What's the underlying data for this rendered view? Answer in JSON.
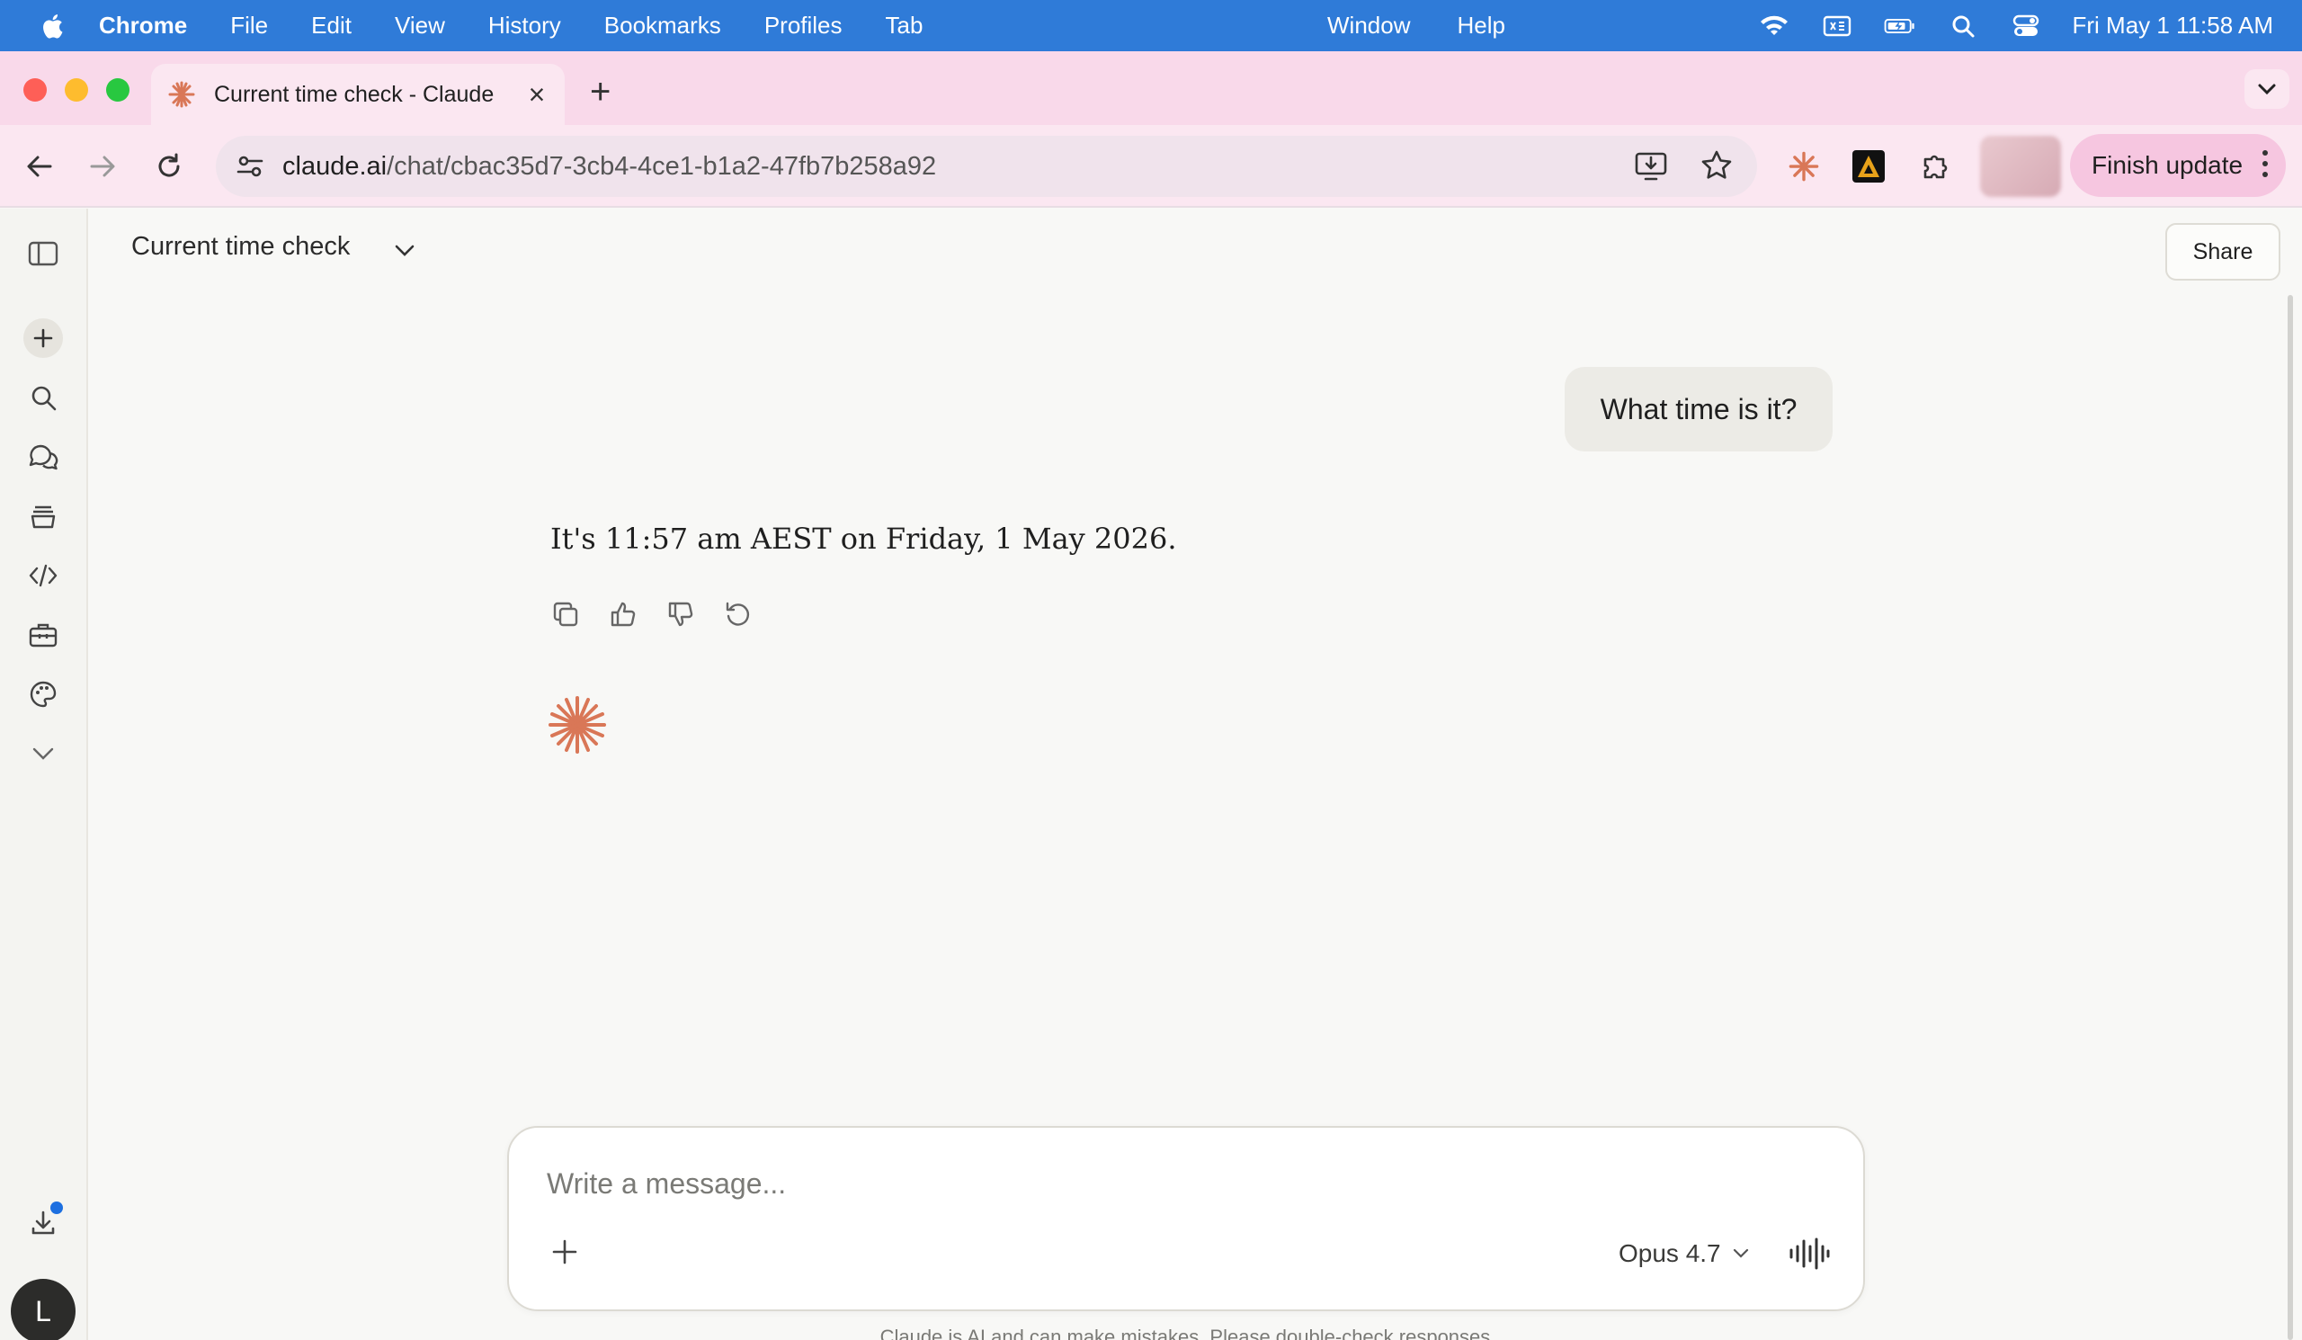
{
  "menubar": {
    "app": "Chrome",
    "items": [
      "File",
      "Edit",
      "View",
      "History",
      "Bookmarks",
      "Profiles",
      "Tab"
    ],
    "center_items": [
      "Window",
      "Help"
    ],
    "clock": "Fri May 1  11:58 AM"
  },
  "tab": {
    "title": "Current time check - Claude",
    "close": "×",
    "new_tab": "+"
  },
  "toolbar": {
    "url_domain": "claude.ai",
    "url_path": "/chat/cbac35d7-3cb4-4ce1-b1a2-47fb7b258a92",
    "finish_update": "Finish update"
  },
  "header": {
    "chat_title": "Current time check",
    "share_label": "Share"
  },
  "conversation": {
    "user_message": "What time is it?",
    "assistant_message": "It's 11:57 am AEST on Friday, 1 May 2026."
  },
  "composer": {
    "placeholder": "Write a message...",
    "model_label": "Opus 4.7"
  },
  "footer": {
    "disclaimer": "Claude is AI and can make mistakes. Please double-check responses."
  },
  "sidebar": {
    "avatar_initial": "L"
  },
  "colors": {
    "menubar": "#2f7bd8",
    "tabstrip": "#f9d9ea",
    "accent": "#d97757"
  }
}
